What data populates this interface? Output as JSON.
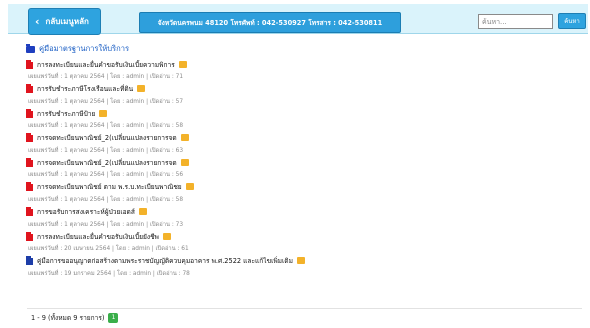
{
  "header": {
    "home_label": "กลับเมนูหลัก",
    "contact": "โทรศัพท์ : 042-530927 โทรสาร : 042-530811",
    "contact_full": "จังหวัดนครพนม 48120 โทรศัพท์ : 042-530927 โทรสาร : 042-530811",
    "search_placeholder": "ค้นหา...",
    "search_button": "ค้นหา"
  },
  "section": {
    "title": "คู่มือมาตรฐานการให้บริการ"
  },
  "items": [
    {
      "title": "การลงทะเบียนและยื่นคำขอรับเงินเบี้ยความพิการ",
      "meta": "เผยแพร่วันที่ : 1 ตุลาคม 2564 | โดย : admin | เปิดอ่าน : 71",
      "icon": "red"
    },
    {
      "title": "การรับชำระภาษีโรงเรือนและที่ดิน",
      "meta": "เผยแพร่วันที่ : 1 ตุลาคม 2564 | โดย : admin | เปิดอ่าน : 57",
      "icon": "red"
    },
    {
      "title": "การรับชำระภาษีป้าย",
      "meta": "เผยแพร่วันที่ : 1 ตุลาคม 2564 | โดย : admin | เปิดอ่าน : 58",
      "icon": "red"
    },
    {
      "title": "การจดทะเบียนพาณิชย์_2(เปลี่ยนแปลงรายการจด",
      "meta": "เผยแพร่วันที่ : 1 ตุลาคม 2564 | โดย : admin | เปิดอ่าน : 63",
      "icon": "red"
    },
    {
      "title": "การจดทะเบียนพาณิชย์_2(เปลี่ยนแปลงรายการจด",
      "meta": "เผยแพร่วันที่ : 1 ตุลาคม 2564 | โดย : admin | เปิดอ่าน : 56",
      "icon": "red"
    },
    {
      "title": "การจดทะเบียนพาณิชย์ ตาม พ.ร.บ.ทะเบียนพาณิชย",
      "meta": "เผยแพร่วันที่ : 1 ตุลาคม 2564 | โดย : admin | เปิดอ่าน : 58",
      "icon": "red"
    },
    {
      "title": "การขอรับการสงเคราะห์ผู้ป่วยเอดส์",
      "meta": "เผยแพร่วันที่ : 1 ตุลาคม 2564 | โดย : admin | เปิดอ่าน : 73",
      "icon": "red"
    },
    {
      "title": "การลงทะเบียนและยื่นคำขอรับเงินเบี้ยยังชีพ",
      "meta": "เผยแพร่วันที่ : 20 เมษายน 2564 | โดย : admin | เปิดอ่าน : 61",
      "icon": "red"
    },
    {
      "title": "คู่มือการขออนุญาตก่อสร้างตามพระราชบัญญัติควบคุมอาคาร พ.ศ.2522 และแก้ไขเพิ่มเติม",
      "meta": "เผยแพร่วันที่ : 19 มกราคม 2564 | โดย : admin | เปิดอ่าน : 78",
      "icon": "blue"
    }
  ],
  "badge_text": "new",
  "pagination": {
    "summary": "1 - 9 (ทั้งหมด 9 รายการ)",
    "page": "1"
  }
}
